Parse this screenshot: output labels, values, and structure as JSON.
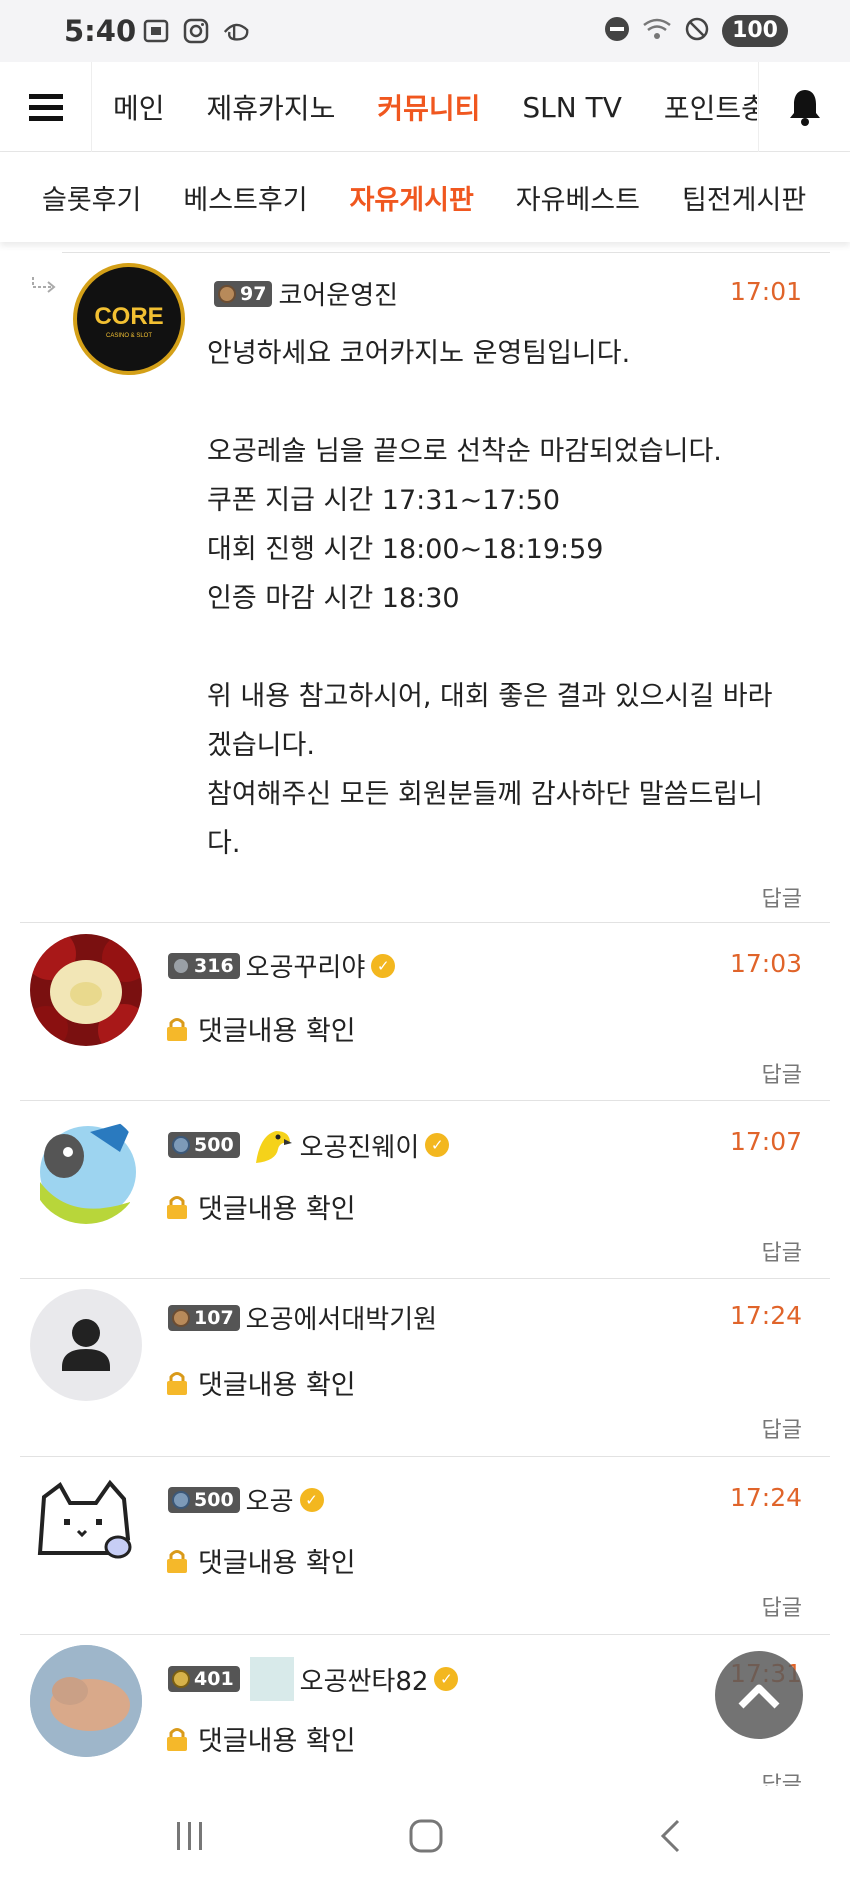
{
  "status_bar": {
    "time": "5:40",
    "battery": "100",
    "left_icons": [
      "screenshot-icon",
      "instagram-icon",
      "disney-icon"
    ],
    "right_icons": [
      "dnd-icon",
      "wifi-icon",
      "blocked-icon"
    ]
  },
  "main_nav": {
    "items": [
      {
        "label": "메인",
        "active": false
      },
      {
        "label": "제휴카지노",
        "active": false
      },
      {
        "label": "커뮤니티",
        "active": true
      },
      {
        "label": "SLN TV",
        "active": false
      },
      {
        "label": "포인트충",
        "active": false
      }
    ]
  },
  "sub_nav": {
    "items": [
      {
        "label": "슬롯후기",
        "active": false
      },
      {
        "label": "베스트후기",
        "active": false
      },
      {
        "label": "자유게시판",
        "active": true
      },
      {
        "label": "자유베스트",
        "active": false
      },
      {
        "label": "팁전게시판",
        "active": false
      }
    ]
  },
  "comments": [
    {
      "level": "97",
      "nickname": "코어운영진",
      "time": "17:01",
      "avatar_text": "CORE",
      "avatar_subtext": "CASINO & SLOT",
      "body": "안녕하세요 코어카지노 운영팀입니다.\n\n오공레솔 님을 끝으로 선착순 마감되었습니다.\n쿠폰 지급 시간 17:31~17:50\n대회 진행 시간 18:00~18:19:59\n인증 마감 시간 18:30\n\n위 내용 참고하시어, 대회 좋은 결과 있으시길 바라\n겠습니다.\n참여해주신 모든 회원분들께 감사하단 말씀드립니\n다.",
      "reply": "답글"
    },
    {
      "level": "316",
      "nickname": "오공꾸리야",
      "time": "17:03",
      "secret_text": "댓글내용 확인",
      "reply": "답글"
    },
    {
      "level": "500",
      "nickname": "오공진웨이",
      "time": "17:07",
      "secret_text": "댓글내용 확인",
      "reply": "답글"
    },
    {
      "level": "107",
      "nickname": "오공에서대박기원",
      "time": "17:24",
      "secret_text": "댓글내용 확인",
      "reply": "답글"
    },
    {
      "level": "500",
      "nickname": "오공",
      "time": "17:24",
      "secret_text": "댓글내용 확인",
      "reply": "답글"
    },
    {
      "level": "401",
      "nickname": "오공싼타82",
      "time": "17:31",
      "secret_text": "댓글내용 확인",
      "reply": "답글"
    }
  ],
  "colors": {
    "accent": "#f0571f",
    "time": "#e0642a",
    "verified": "#f3b71f"
  }
}
